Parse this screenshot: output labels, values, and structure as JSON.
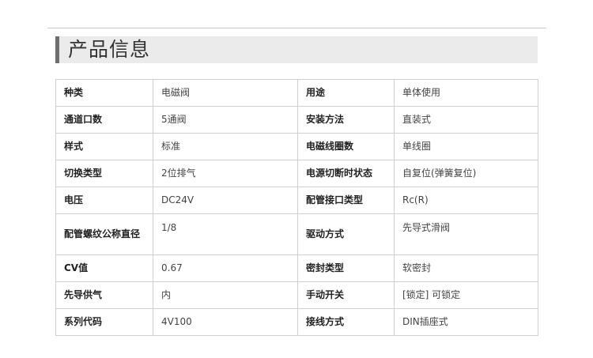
{
  "section": {
    "title": "产品信息"
  },
  "spec_rows": [
    {
      "k1": "种类",
      "v1": "电磁阀",
      "k2": "用途",
      "v2": "单体使用"
    },
    {
      "k1": "通道口数",
      "v1": "5通阀",
      "k2": "安装方法",
      "v2": "直装式"
    },
    {
      "k1": "样式",
      "v1": "标准",
      "k2": "电磁线圈数",
      "v2": "单线圈"
    },
    {
      "k1": "切换类型",
      "v1": "2位排气",
      "k2": "电源切断时状态",
      "v2": "自复位(弹簧复位)"
    },
    {
      "k1": "电压",
      "v1": "DC24V",
      "k2": "配管接口类型",
      "v2": "Rc(R)"
    },
    {
      "k1": "配管螺纹公称直径",
      "v1": "1/8",
      "k2": "驱动方式",
      "v2": "先导式滑阀"
    },
    {
      "k1": "CV值",
      "v1": "0.67",
      "k2": "密封类型",
      "v2": "软密封"
    },
    {
      "k1": "先导供气",
      "v1": "内",
      "k2": "手动开关",
      "v2": "[锁定] 可锁定"
    },
    {
      "k1": "系列代码",
      "v1": "4V100",
      "k2": "接线方式",
      "v2": "DIN插座式"
    }
  ]
}
